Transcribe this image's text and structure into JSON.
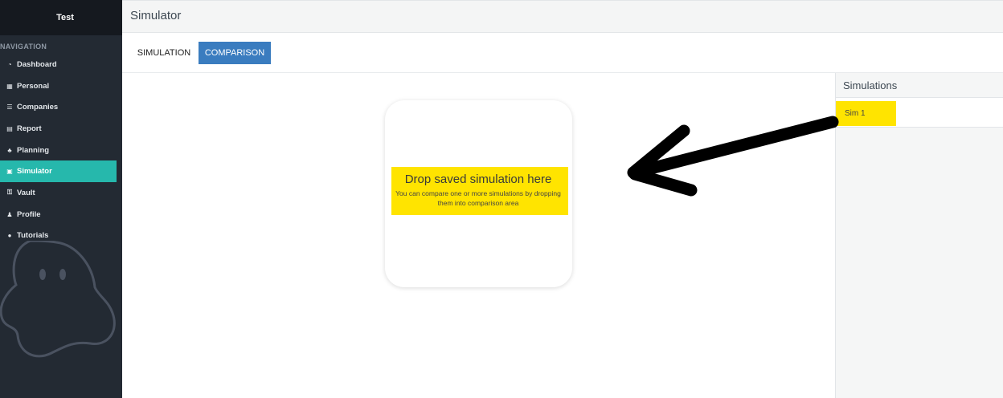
{
  "sidebar": {
    "brand": "Test",
    "heading": "NAVIGATION",
    "items": [
      {
        "label": "Dashboard",
        "icon": "dashboard-icon",
        "glyph": "◔"
      },
      {
        "label": "Personal",
        "icon": "table-icon",
        "glyph": "▦"
      },
      {
        "label": "Companies",
        "icon": "list-icon",
        "glyph": "☰"
      },
      {
        "label": "Report",
        "icon": "file-icon",
        "glyph": "▤"
      },
      {
        "label": "Planning",
        "icon": "sitemap-icon",
        "glyph": "♣"
      },
      {
        "label": "Simulator",
        "icon": "calculator-icon",
        "glyph": "▣"
      },
      {
        "label": "Vault",
        "icon": "key-icon",
        "glyph": "⚿"
      },
      {
        "label": "Profile",
        "icon": "user-icon",
        "glyph": "♟"
      },
      {
        "label": "Tutorials",
        "icon": "info-icon",
        "glyph": "●"
      }
    ],
    "active_item": "Simulator",
    "active_color": "#26b8ac"
  },
  "header": {
    "title": "Simulator"
  },
  "tabs": [
    {
      "label": "SIMULATION",
      "active": false
    },
    {
      "label": "COMPARISON",
      "active": true
    }
  ],
  "comparison": {
    "drop_title": "Drop saved simulation here",
    "drop_subtitle": "You can compare one or more simulations by dropping them into comparison area"
  },
  "simulations_panel": {
    "title": "Simulations",
    "items": [
      "Sim 1"
    ]
  },
  "colors": {
    "highlight": "#ffe400",
    "tab_active": "#3a7cbf",
    "sidebar_bg": "#232a33"
  }
}
